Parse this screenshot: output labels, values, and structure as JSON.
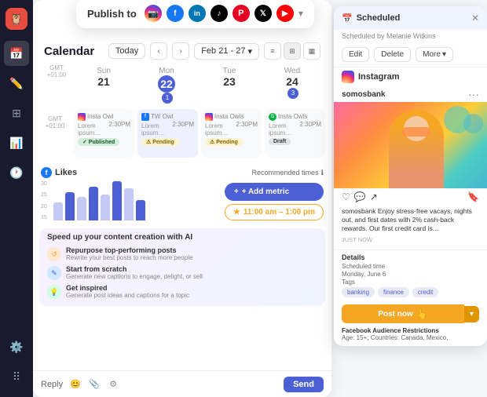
{
  "sidebar": {
    "logo": "🦉",
    "items": [
      {
        "name": "calendar",
        "icon": "📅",
        "active": true
      },
      {
        "name": "compose",
        "icon": "✏️",
        "active": false
      },
      {
        "name": "grid",
        "icon": "⊞",
        "active": false
      },
      {
        "name": "analytics",
        "icon": "📊",
        "active": false
      },
      {
        "name": "clock",
        "icon": "🕐",
        "active": false
      },
      {
        "name": "settings",
        "icon": "⚙️",
        "active": false
      },
      {
        "name": "apps",
        "icon": "⠿",
        "active": false
      }
    ]
  },
  "publishBar": {
    "label": "Publish to",
    "networks": [
      "instagram",
      "facebook",
      "linkedin",
      "tiktok",
      "pinterest",
      "twitter",
      "youtube"
    ],
    "moreIcon": "▾"
  },
  "calendar": {
    "title": "Calendar",
    "todayBtn": "Today",
    "dateRange": "Feb 21 - 27",
    "dateRangeIcon": "▾",
    "gmt": "GMT +01:00",
    "days": [
      {
        "name": "Sun",
        "num": "21",
        "today": false,
        "badge": null
      },
      {
        "name": "Mon",
        "num": "22",
        "today": true,
        "badge": "1"
      },
      {
        "name": "Tue",
        "num": "23",
        "today": false,
        "badge": null
      },
      {
        "name": "Wed",
        "num": "24",
        "today": false,
        "badge": "3"
      }
    ],
    "posts": [
      {
        "day": "Sun",
        "icon": "ig",
        "time": "2:30PM",
        "title": "Insta Owl",
        "desc": "Lorem ipsum dolre...",
        "status": "Published"
      },
      {
        "day": "Mon",
        "icon": "fb",
        "time": "2:30PM",
        "title": "TW Owl",
        "desc": "Lorem ipsum dolre...",
        "status": "Pending"
      },
      {
        "day": "Tue",
        "icon": "ig",
        "time": "2:30PM",
        "title": "Insta Owls",
        "desc": "Lorem ipsum dolre...",
        "status": "Pending"
      },
      {
        "day": "Wed",
        "icon": "sp",
        "time": "2:30PM",
        "title": "Insta Owls",
        "desc": "Lorem ipsum dolre...",
        "status": "Draft"
      }
    ]
  },
  "likes": {
    "title": "Likes",
    "fbIcon": "f",
    "bars": [
      14,
      22,
      18,
      26,
      20,
      30,
      25,
      16
    ],
    "yLabels": [
      "30",
      "25",
      "20",
      "15"
    ],
    "recommendedTimes": "Recommended times",
    "infoIcon": "ℹ",
    "timeChip": "11:00 am – 1:00 pm",
    "starIcon": "★"
  },
  "addMetric": {
    "label": "+ Add metric"
  },
  "ai": {
    "title": "Speed up your content creation with AI",
    "items": [
      {
        "iconLabel": "↺",
        "title": "Repurpose top-performing posts",
        "desc": "Rewrite your best posts to reach more people"
      },
      {
        "iconLabel": "✎",
        "title": "Start from scratch",
        "desc": "Generate new captions to engage, delight, or sell"
      },
      {
        "iconLabel": "💡",
        "title": "Get inspired",
        "desc": "Generate post ideas and captions for a topic"
      }
    ]
  },
  "reply": {
    "label": "Reply",
    "sendLabel": "Send"
  },
  "scheduled": {
    "title": "Scheduled",
    "scheduledBy": "Scheduled by Melanie Wilkins",
    "editBtn": "Edit",
    "deleteBtn": "Delete",
    "moreBtn": "More",
    "moreBtnIcon": "▾",
    "platform": "Instagram",
    "account": "somosbank",
    "accountDots": "···",
    "caption": "somosbank Enjoy stress-free vacays, nights out, and first dates with 2% cash-back rewards. Our first credit card is...",
    "timeAgo": "JUST NOW",
    "details": {
      "title": "Details",
      "scheduledTimeLabel": "Scheduled time",
      "scheduledTimeValue": "Monday, June 6",
      "tagsLabel": "Tags",
      "tags": [
        "banking",
        "finance",
        "credit"
      ],
      "fbRestrictionsLabel": "Facebook Audience Restrictions",
      "fbRestrictionsValue": "Age: 15+; Countries: Canada, Mexico,"
    },
    "postNowBtn": "Post now",
    "postNowDropdown": "▾",
    "closeIcon": "✕"
  }
}
